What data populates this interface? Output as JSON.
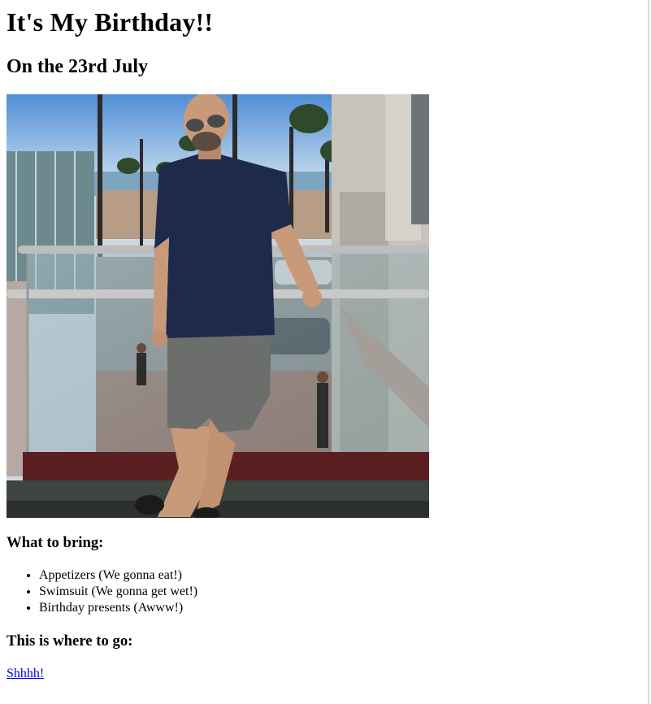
{
  "header": {
    "title": "It's My Birthday!!",
    "date_subtitle": "On the 23rd July"
  },
  "photo": {
    "subject": "birthday-person-photo"
  },
  "bring": {
    "heading": "What to bring:",
    "items": [
      {
        "label": "Appetizers (We gonna eat!)"
      },
      {
        "label": "Swimsuit (We gonna get wet!)"
      },
      {
        "label": "Birthday presents (Awww!)"
      }
    ]
  },
  "where": {
    "heading": "This is where to go:",
    "link_label": "Shhhh!"
  },
  "colors": {
    "link": "#0000ee",
    "text": "#000000",
    "background": "#ffffff"
  }
}
